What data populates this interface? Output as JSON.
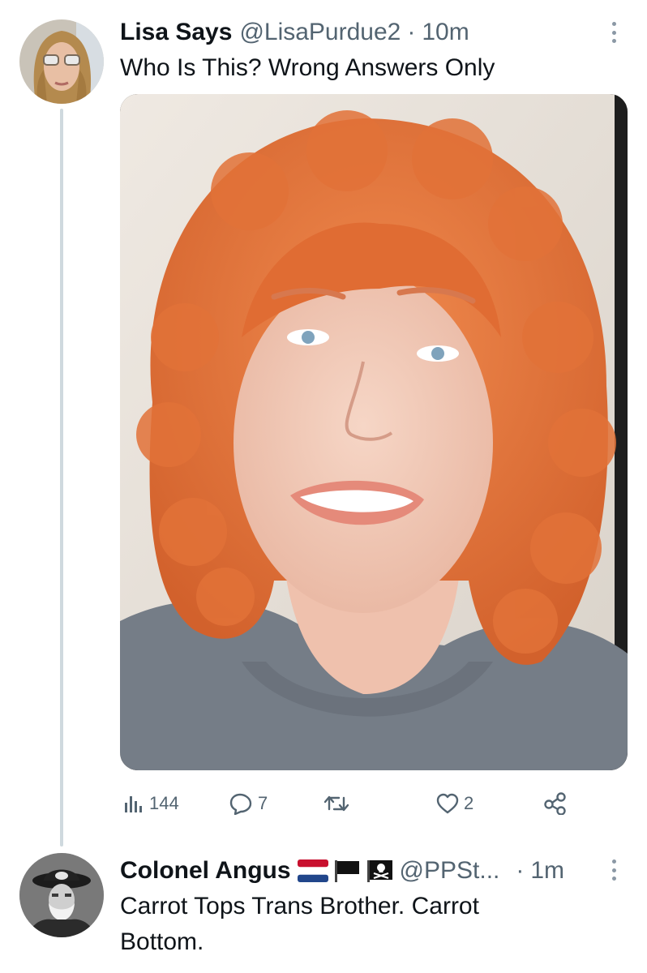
{
  "tweet": {
    "author_name": "Lisa Says",
    "handle": "@LisaPurdue2",
    "separator": "·",
    "time": "10m",
    "text": "Who Is This? Wrong Answers Only",
    "stats": {
      "views": "144",
      "replies": "7",
      "retweets": "",
      "likes": "2"
    }
  },
  "reply": {
    "author_name": "Colonel Angus",
    "handle": "@PPSt...",
    "separator": "·",
    "time": "1m",
    "text_line1": "Carrot Tops Trans Brother. Carrot",
    "text_line2": "Bottom."
  },
  "icons": [
    "views-icon",
    "reply-icon",
    "retweet-icon",
    "like-icon",
    "share-icon",
    "more-icon",
    "netherlands-flag-icon",
    "black-flag-icon",
    "pirate-flag-icon"
  ],
  "colors": {
    "text": "#0f1419",
    "secondary": "#536471",
    "thread_line": "#cfd9de",
    "hair": "#e8733a"
  }
}
